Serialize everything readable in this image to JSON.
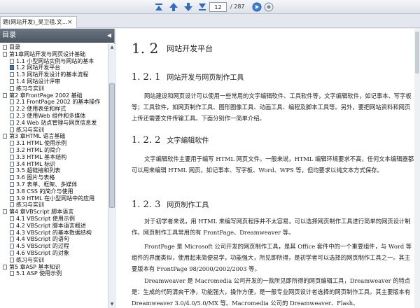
{
  "toolbar": {
    "page_current": "12",
    "page_total": "/ 287"
  },
  "tab": {
    "title": "题(网站开发)_吴卫祖.文...",
    "close": "×"
  },
  "sidebar": {
    "title": "目录",
    "collapse": "◀",
    "items": [
      {
        "label": "目录",
        "level": 0
      },
      {
        "label": "第1章网站开发与网页设计基础",
        "level": 0
      },
      {
        "label": "1.1 小型网站实例与网站的基本",
        "level": 1
      },
      {
        "label": "1.2 网站开发平台",
        "level": 1,
        "selected": true
      },
      {
        "label": "1.3 网站开发设计的基本流程",
        "level": 1
      },
      {
        "label": "1.4 网站设计评审",
        "level": 1
      },
      {
        "label": "练习与实训",
        "level": 1
      },
      {
        "label": "第2 章FrontPage 2002 基础",
        "level": 0
      },
      {
        "label": "2.1 FrontPage 2002 的基本操作",
        "level": 1
      },
      {
        "label": "2.2 使用表单和样式",
        "level": 1
      },
      {
        "label": "2.3 使用Web 组件和多媒体",
        "level": 1
      },
      {
        "label": "2.4 Web 站点管理与网页信息发",
        "level": 1
      },
      {
        "label": "练习与实训",
        "level": 1
      },
      {
        "label": "第3 章HTML 语言基础",
        "level": 0
      },
      {
        "label": "3.1 HTML 使用示例",
        "level": 1
      },
      {
        "label": "3.2 HTML 的简介",
        "level": 1
      },
      {
        "label": "3.3 HTML 基本结构",
        "level": 1
      },
      {
        "label": "3.4 HTML 标识",
        "level": 1
      },
      {
        "label": "3.5 超链接和列表",
        "level": 1
      },
      {
        "label": "3.6 图片与表格",
        "level": 1
      },
      {
        "label": "3.7 表单、框架、多媒体",
        "level": 1
      },
      {
        "label": "3.8 CSS 的简介与使用",
        "level": 1
      },
      {
        "label": "3.9 HTML 在小型网站中的应用",
        "level": 1
      },
      {
        "label": "练习与实训",
        "level": 1
      },
      {
        "label": "第4 章VBScript 脚本语言",
        "level": 0
      },
      {
        "label": "4.1 VBScript 使用示例",
        "level": 1
      },
      {
        "label": "4.2 VBScript 脚本语言概述",
        "level": 1
      },
      {
        "label": "4.3 VBScript 的基本数据结构",
        "level": 1
      },
      {
        "label": "4.4 VBScript 的语句",
        "level": 1
      },
      {
        "label": "4.5 VBScript 的过程",
        "level": 1
      },
      {
        "label": "4.6 VBScript 的对象",
        "level": 1
      },
      {
        "label": "练习与实训",
        "level": 1
      },
      {
        "label": "第5 章ASP 基本知识",
        "level": 0
      },
      {
        "label": "5.1 ASP 使用示例",
        "level": 1
      }
    ]
  },
  "document": {
    "h1_num": "1. 2",
    "h1_text": "网站开发平台",
    "s1_num": "1. 2. 1",
    "s1_text": "网站开发与网页制作工具",
    "p1": "网站建设和网页设计可以使用一些常用的文字编辑软件、工具软件等，文字编辑软件，如记事本、写字板等；工具软件，如网页制作工具、图形图像工具、动画工具、编程及脚本工具等。另外，要把网站资料和网页上传还需要文件传输工具。下面分别作一简单介绍。",
    "s2_num": "1. 2. 2",
    "s2_text": "文字编辑软件",
    "p2": "文字编辑软件主要用于编写 HTML 网页文件。一般来说，HTML 编辑环境要求不高，任何文本编辑器都可以用来编辑 HTML 网页，如记事本、写字板、Word、WPS 等，但均要求以纯文本方式保存。",
    "s3_num": "1. 2. 3",
    "s3_text": "网页制作工具",
    "p3": "对于初学者来说，用 HTML 来编写网页程序并不太容易，可以选择网页制作工具进行简单的网页设计制作。网页制作工具常用的有 FrontPage、Dreamweaver 等。",
    "p4": "FrontPage 是 Microsoft 公司开发的网页制作工具，是其 Office 套件中的一个重要组件，与 Word 等组件的界面类似，使用起来简便易学，功能强大，所见即所得，是初学者可以选择的网页制作工具之一。其主要版本有 FrontPage 98/2000/2002/2003 等。",
    "p5": "Dreamweaver 是 Macromedia 公司开发的一款所见即所得的网页编辑工具，Dreamweaver 的特点是：生成的代码清爽干净，功能强大，操作方便，是一般专业网页设计者选择的网页制作工具。其主要版本有 Dreamweaver 3.0/4.0/5.0/MX 等。Macromedia 公司的 Dreamweaver、Flash、"
  }
}
